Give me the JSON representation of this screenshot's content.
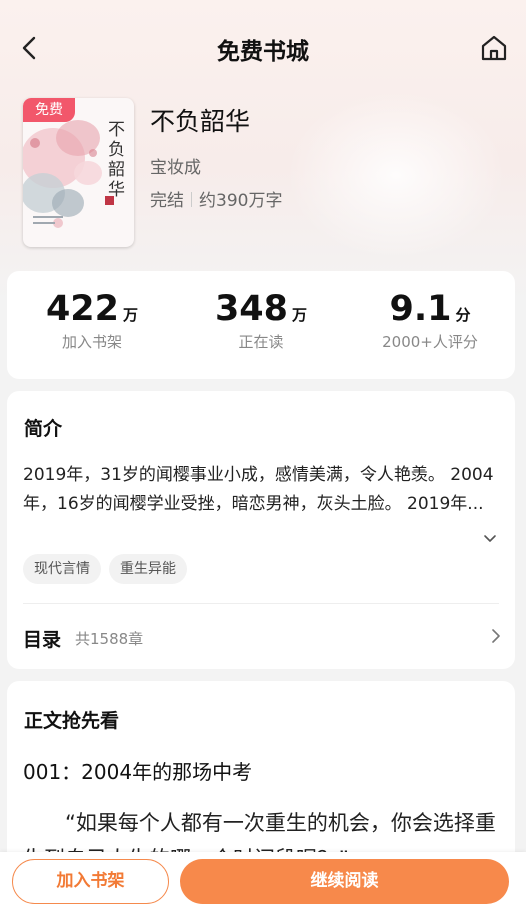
{
  "header": {
    "title": "免费书城"
  },
  "book": {
    "badge": "免费",
    "title": "不负韶华",
    "author": "宝妆成",
    "status": "完结",
    "word_count": "约390万字",
    "cover_title": "不负韶华"
  },
  "stats": [
    {
      "value": "422",
      "unit": "万",
      "label": "加入书架"
    },
    {
      "value": "348",
      "unit": "万",
      "label": "正在读"
    },
    {
      "value": "9.1",
      "unit": "分",
      "label": "2000+人评分"
    }
  ],
  "intro": {
    "title": "简介",
    "text": "2019年，31岁的闻樱事业小成，感情美满，令人艳羡。 2004年，16岁的闻樱学业受挫，暗恋男神，灰头土脸。 2019年...",
    "tags": [
      "现代言情",
      "重生异能"
    ]
  },
  "toc": {
    "label": "目录",
    "count": "共1588章"
  },
  "preview": {
    "title": "正文抢先看",
    "chapter": "001：2004年的那场中考",
    "body": "“如果每个人都有一次重生的机会，你会选择重生到自己人生的哪一个时间段呢？”"
  },
  "bottom": {
    "add_shelf": "加入书架",
    "continue": "继续阅读"
  },
  "colors": {
    "accent": "#f7894b",
    "badge": "#f2576b"
  }
}
